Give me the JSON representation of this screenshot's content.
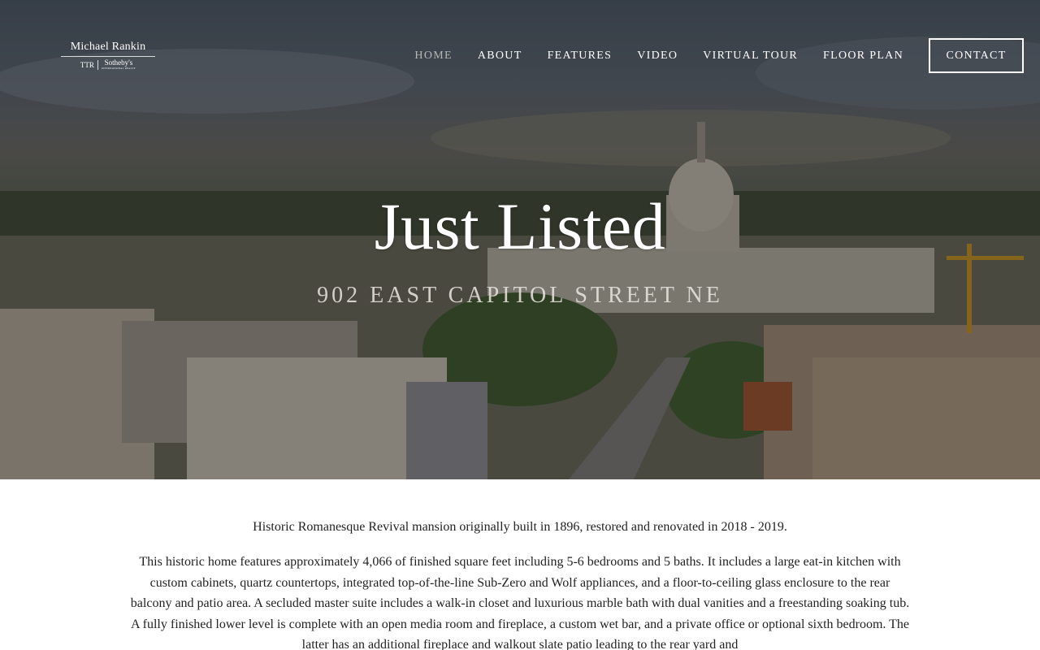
{
  "logo": {
    "name": "Michael Rankin",
    "ttr": "TTR",
    "brand": "Sotheby's",
    "brand_tagline": "INTERNATIONAL REALTY"
  },
  "nav": {
    "items": [
      {
        "label": "HOME",
        "active": true
      },
      {
        "label": "ABOUT",
        "active": false
      },
      {
        "label": "FEATURES",
        "active": false
      },
      {
        "label": "VIDEO",
        "active": false
      },
      {
        "label": "VIRTUAL TOUR",
        "active": false
      },
      {
        "label": "FLOOR PLAN",
        "active": false
      }
    ],
    "contact": "CONTACT"
  },
  "hero": {
    "title": "Just Listed",
    "subtitle": "902 EAST CAPITOL STREET NE"
  },
  "content": {
    "intro": "Historic Romanesque Revival mansion originally built in 1896, restored and renovated in 2018 - 2019.",
    "description": "This historic home features approximately 4,066 of finished square feet including 5-6 bedrooms and 5 baths.  It includes a large eat-in kitchen with custom cabinets, quartz countertops, integrated top-of-the-line Sub-Zero and Wolf appliances, and a floor-to-ceiling glass enclosure to the rear balcony and patio area. A secluded master suite includes a walk-in closet and luxurious marble bath with dual vanities and a freestanding soaking tub. A fully finished lower level is complete with an open media room and fireplace, a custom wet bar, and a private office or optional sixth bedroom.  The latter has an additional fireplace and walkout slate patio leading to the rear yard and"
  },
  "colors": {
    "nav_active": "#b7b7b7",
    "nav_text": "#ffffff",
    "body_text": "#222222"
  }
}
